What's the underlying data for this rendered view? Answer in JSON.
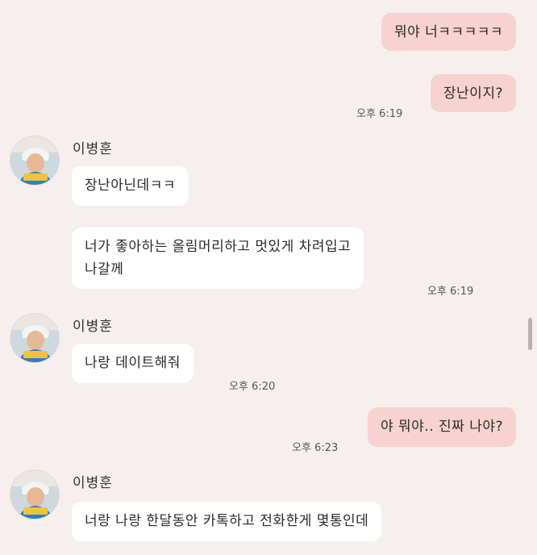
{
  "contact": {
    "name": "이병훈"
  },
  "messages": [
    {
      "side": "me",
      "text": "뭐야 너ㅋㅋㅋㅋㅋ"
    },
    {
      "side": "me",
      "text": "장난이지?",
      "time": "오후 6:19"
    },
    {
      "side": "them",
      "text": "장난아닌데ㅋㅋ"
    },
    {
      "side": "them",
      "lines": [
        "너가 좋아하는 올림머리하고 멋있게 차려입고",
        "나갈께"
      ],
      "time": "오후 6:19"
    },
    {
      "side": "them",
      "text": "나랑 데이트해줘",
      "time": "오후 6:20"
    },
    {
      "side": "me",
      "text": "야 뭐야.. 진짜 나야?",
      "time": "오후 6:23"
    },
    {
      "side": "them",
      "text": "너랑 나랑 한달동안 카톡하고 전화한게 몇통인데"
    }
  ],
  "colors": {
    "background": "#f6efed",
    "my_bubble": "#f8d2cf",
    "their_bubble": "#ffffff"
  },
  "icons": {
    "avatar": "profile-photo"
  }
}
